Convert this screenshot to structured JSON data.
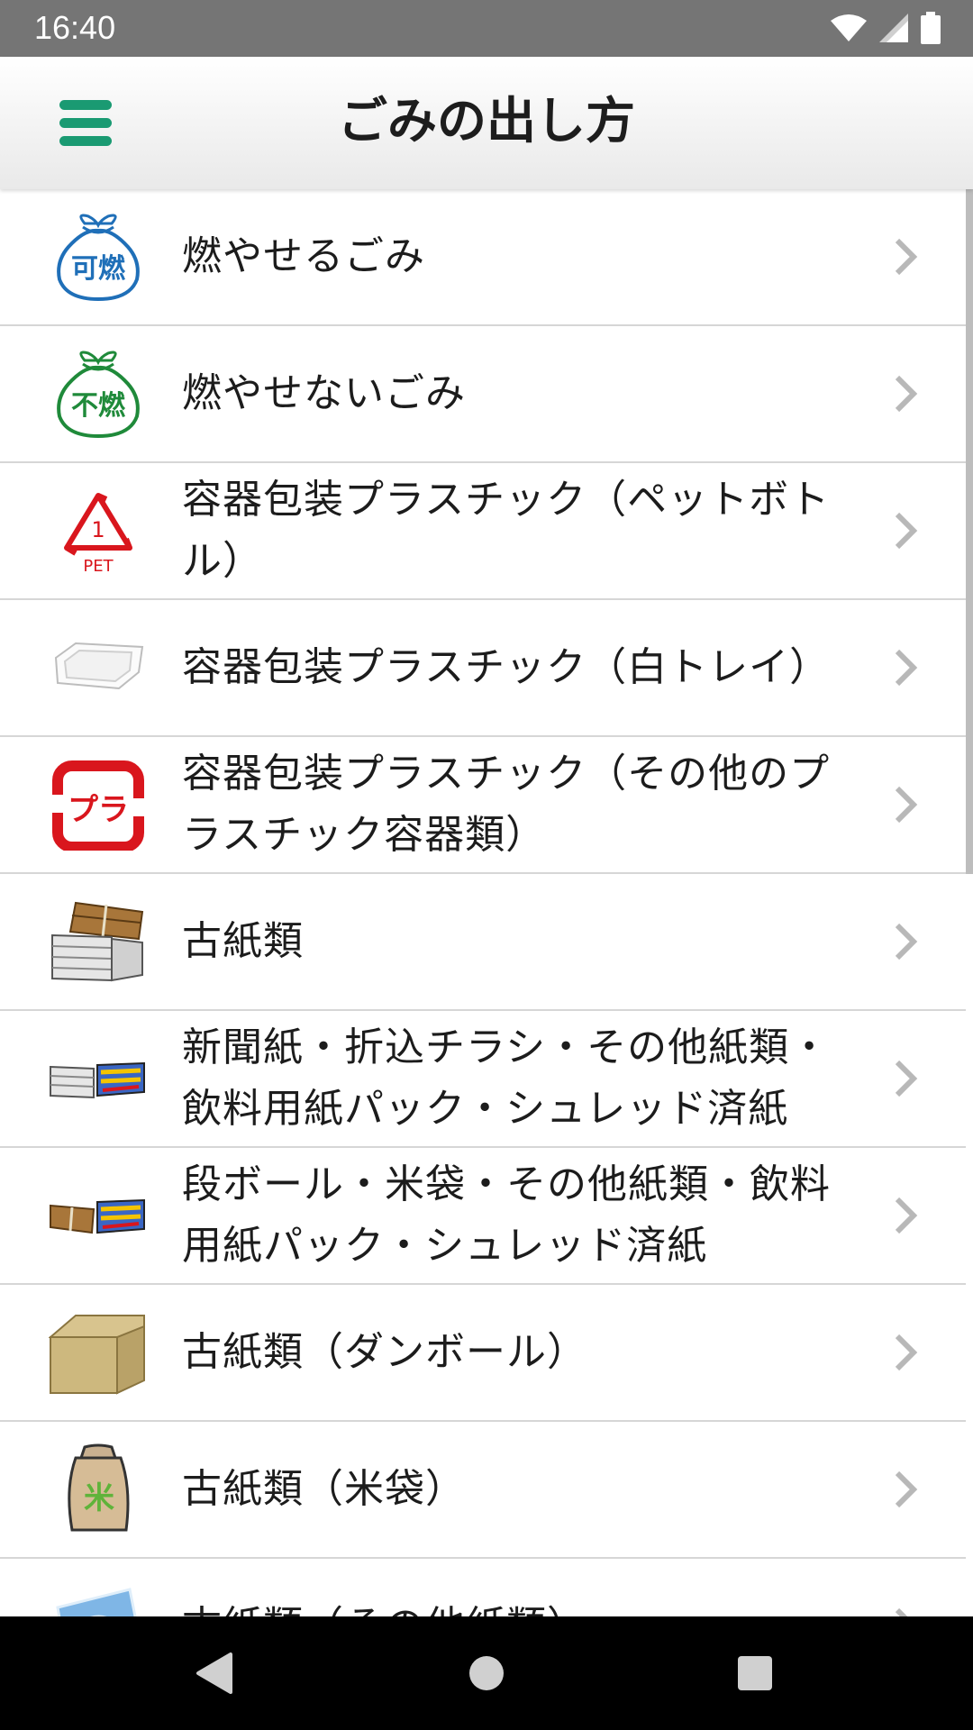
{
  "status_bar": {
    "time": "16:40",
    "icons": [
      "wifi-icon",
      "signal-icon",
      "battery-icon"
    ]
  },
  "app_bar": {
    "title": "ごみの出し方",
    "menu_icon": "hamburger-menu-icon"
  },
  "list": {
    "items": [
      {
        "label": "燃やせるごみ",
        "icon": "burnable-bag-icon",
        "icon_text": "可燃",
        "color": "#1f6fb8"
      },
      {
        "label": "燃やせないごみ",
        "icon": "non-burnable-bag-icon",
        "icon_text": "不燃",
        "color": "#1f8a3a"
      },
      {
        "label": "容器包装プラスチック（ペットボトル）",
        "icon": "pet-recycle-icon",
        "icon_text": "PET",
        "color": "#d9161d"
      },
      {
        "label": "容器包装プラスチック（白トレイ）",
        "icon": "white-tray-icon"
      },
      {
        "label": "容器包装プラスチック（その他のプラスチック容器類）",
        "icon": "plastic-mark-icon",
        "icon_text": "プラ",
        "color": "#d9161d"
      },
      {
        "label": "古紙類",
        "icon": "paper-bundle-icon"
      },
      {
        "label": "新聞紙・折込チラシ・その他紙類・飲料用紙パック・シュレッド済紙",
        "icon": "newspaper-bundle-icon"
      },
      {
        "label": "段ボール・米袋・その他紙類・飲料用紙パック・シュレッド済紙",
        "icon": "cardboard-bundle-icon"
      },
      {
        "label": "古紙類（ダンボール）",
        "icon": "cardboard-box-icon"
      },
      {
        "label": "古紙類（米袋）",
        "icon": "rice-bag-icon",
        "icon_text": "米"
      },
      {
        "label": "古紙類（その他紙類）",
        "icon": "other-paper-icon"
      }
    ],
    "chevron_icon": "chevron-right-icon"
  },
  "nav_bar": {
    "icons": [
      "back-icon",
      "home-icon",
      "recents-icon"
    ]
  }
}
